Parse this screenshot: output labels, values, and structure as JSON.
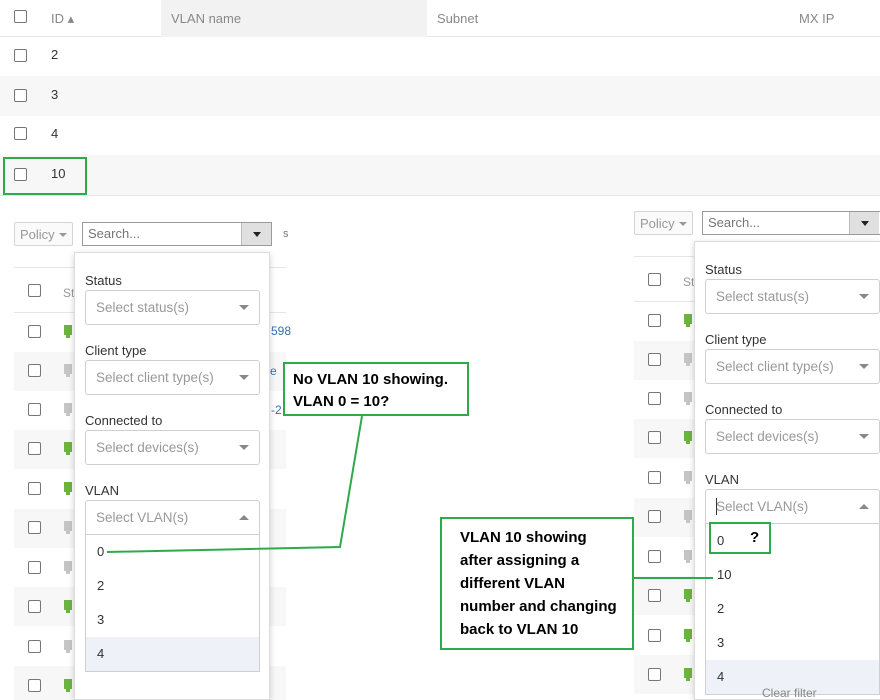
{
  "vlan_table": {
    "headers": {
      "id": "ID ▴",
      "name": "VLAN name",
      "subnet": "Subnet",
      "mx_ip": "MX IP"
    },
    "rows": [
      "2",
      "3",
      "4",
      "10"
    ]
  },
  "left_filter": {
    "policy_label": "Policy",
    "search_placeholder": "Search...",
    "cut_text": "s",
    "status_label": "Status",
    "status_placeholder": "Select status(s)",
    "client_type_label": "Client type",
    "client_type_placeholder": "Select client type(s)",
    "connected_label": "Connected to",
    "connected_placeholder": "Select devices(s)",
    "vlan_label": "VLAN",
    "vlan_placeholder": "Select VLAN(s)",
    "vlan_options": [
      "0",
      "2",
      "3",
      "4"
    ],
    "table_header_fragment": "St",
    "fragments": [
      "598",
      "e",
      "-2"
    ]
  },
  "right_filter": {
    "policy_label": "Policy",
    "search_placeholder": "Search...",
    "status_label": "Status",
    "status_placeholder": "Select status(s)",
    "client_type_label": "Client type",
    "client_type_placeholder": "Select client type(s)",
    "connected_label": "Connected to",
    "connected_placeholder": "Select devices(s)",
    "vlan_label": "VLAN",
    "vlan_placeholder": "Select VLAN(s)",
    "vlan_options": [
      "0",
      "10",
      "2",
      "3",
      "4"
    ],
    "table_header_fragment": "St",
    "clear_filter": "Clear filter"
  },
  "annotations": {
    "note_left": "No VLAN 10 showing.\nVLAN 0 = 10?",
    "note_right": "VLAN 10 showing\nafter assigning a\ndifferent VLAN\nnumber and changing\nback to VLAN 10",
    "question_mark": "?"
  },
  "colors": {
    "annotation_green": "#2eaa4a",
    "status_green": "#6cb33f",
    "status_gray": "#c5c5c5",
    "link_blue": "#3a6fb0"
  }
}
